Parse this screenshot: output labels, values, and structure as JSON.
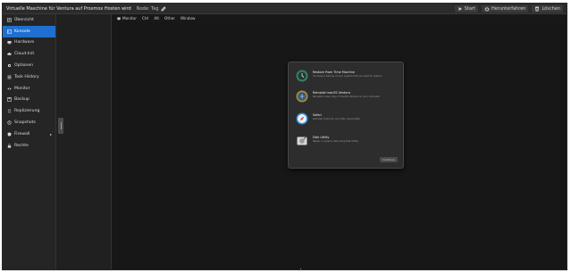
{
  "window": {
    "title": "Virtuelle Maschine für Ventura auf Proxmox Hosten wird",
    "node_tag": "Node: Tag"
  },
  "topbar_actions": [
    {
      "label": "Start",
      "icon": "play-icon"
    },
    {
      "label": "Herunterfahren",
      "icon": "power-icon"
    },
    {
      "label": "Löschen",
      "icon": "trash-icon"
    }
  ],
  "sidebar": {
    "items": [
      {
        "label": "Übersicht",
        "icon": "summary-icon",
        "active": false
      },
      {
        "label": "Konsole",
        "icon": "console-icon",
        "active": true
      },
      {
        "label": "Hardware",
        "icon": "hardware-icon",
        "active": false
      },
      {
        "label": "Cloud-Init",
        "icon": "cloud-icon",
        "active": false
      },
      {
        "label": "Optionen",
        "icon": "gear-icon",
        "active": false
      },
      {
        "label": "Task History",
        "icon": "list-icon",
        "active": false
      },
      {
        "label": "Monitor",
        "icon": "eye-icon",
        "active": false
      },
      {
        "label": "Backup",
        "icon": "floppy-icon",
        "active": false
      },
      {
        "label": "Replizierung",
        "icon": "sync-icon",
        "active": false
      },
      {
        "label": "Snapshots",
        "icon": "history-icon",
        "active": false
      },
      {
        "label": "Firewall",
        "icon": "shield-icon",
        "active": false,
        "caret": "▸"
      },
      {
        "label": "Rechte",
        "icon": "unlock-icon",
        "active": false
      }
    ]
  },
  "console_toolbar": {
    "items": [
      "Monitor",
      "Ctrl",
      "Alt",
      "Other",
      "Window"
    ]
  },
  "recovery_dialog": {
    "options": [
      {
        "title": "Restore From Time Machine",
        "desc": "You have a backup of your system that you want to restore.",
        "icon": "time-machine-icon"
      },
      {
        "title": "Reinstall macOS Ventura",
        "desc": "Reinstall a new copy of macOS Ventura on your computer.",
        "icon": "macos-install-icon"
      },
      {
        "title": "Safari",
        "desc": "Get help online for your Mac using Safari.",
        "icon": "safari-icon"
      },
      {
        "title": "Disk Utility",
        "desc": "Repair or erase a disk using Disk Utility.",
        "icon": "disk-utility-icon"
      }
    ],
    "continue_label": "Continue"
  },
  "colors": {
    "accent": "#1e6fd0",
    "sidebar_bg": "#252525",
    "console_bg": "#171717",
    "dialog_bg": "#2d2d2d"
  }
}
